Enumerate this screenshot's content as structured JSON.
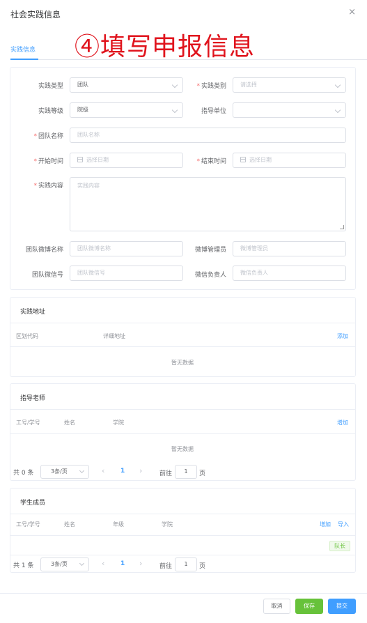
{
  "dialog": {
    "title": "社会实践信息",
    "close_glyph": "×"
  },
  "annotation": "④填写申报信息",
  "tabs": [
    {
      "label": "实践信息"
    }
  ],
  "form": {
    "practice_type": {
      "label": "实践类型",
      "value": "团队"
    },
    "practice_category": {
      "label": "实践类别",
      "placeholder": "请选择"
    },
    "practice_level": {
      "label": "实践等级",
      "value": "院级"
    },
    "guide_unit": {
      "label": "指导单位",
      "value": ""
    },
    "team_name": {
      "label": "团队名称",
      "placeholder": "团队名称"
    },
    "start_time": {
      "label": "开始时间",
      "placeholder": "选择日期"
    },
    "end_time": {
      "label": "结束时间",
      "placeholder": "选择日期"
    },
    "content": {
      "label": "实践内容",
      "placeholder": "实践内容"
    },
    "weibo_name": {
      "label": "团队微博名称",
      "placeholder": "团队微博名称"
    },
    "weibo_admin": {
      "label": "微博管理员",
      "placeholder": "微博管理员"
    },
    "wechat_id": {
      "label": "团队微信号",
      "placeholder": "团队微信号"
    },
    "wechat_owner": {
      "label": "微信负责人",
      "placeholder": "微信负责人"
    }
  },
  "address": {
    "title": "实践地址",
    "columns": [
      "区划代码",
      "详细地址"
    ],
    "add_label": "添加",
    "empty_text": "暂无数据"
  },
  "teachers": {
    "title": "指导老师",
    "columns": [
      "工号/学号",
      "姓名",
      "学院"
    ],
    "add_label": "增加",
    "empty_text": "暂无数据",
    "pagination": {
      "total": "共 0 条",
      "page_size": "3条/页",
      "prev": "‹",
      "current": "1",
      "next": "›",
      "goto_prefix": "前往",
      "goto_value": "1",
      "goto_suffix": "页"
    }
  },
  "students": {
    "title": "学生成员",
    "columns": [
      "工号/学号",
      "姓名",
      "年级",
      "学院"
    ],
    "add_label": "增加",
    "import_label": "导入",
    "rows": [
      {
        "role_tag": "队长"
      }
    ],
    "pagination": {
      "total": "共 1 条",
      "page_size": "3条/页",
      "prev": "‹",
      "current": "1",
      "next": "›",
      "goto_prefix": "前往",
      "goto_value": "1",
      "goto_suffix": "页"
    }
  },
  "footer": {
    "cancel": "取消",
    "save": "保存",
    "submit": "提交"
  },
  "colors": {
    "primary": "#409eff",
    "success": "#67c23a",
    "danger": "#f56c6c",
    "annotation": "#e0141d"
  }
}
